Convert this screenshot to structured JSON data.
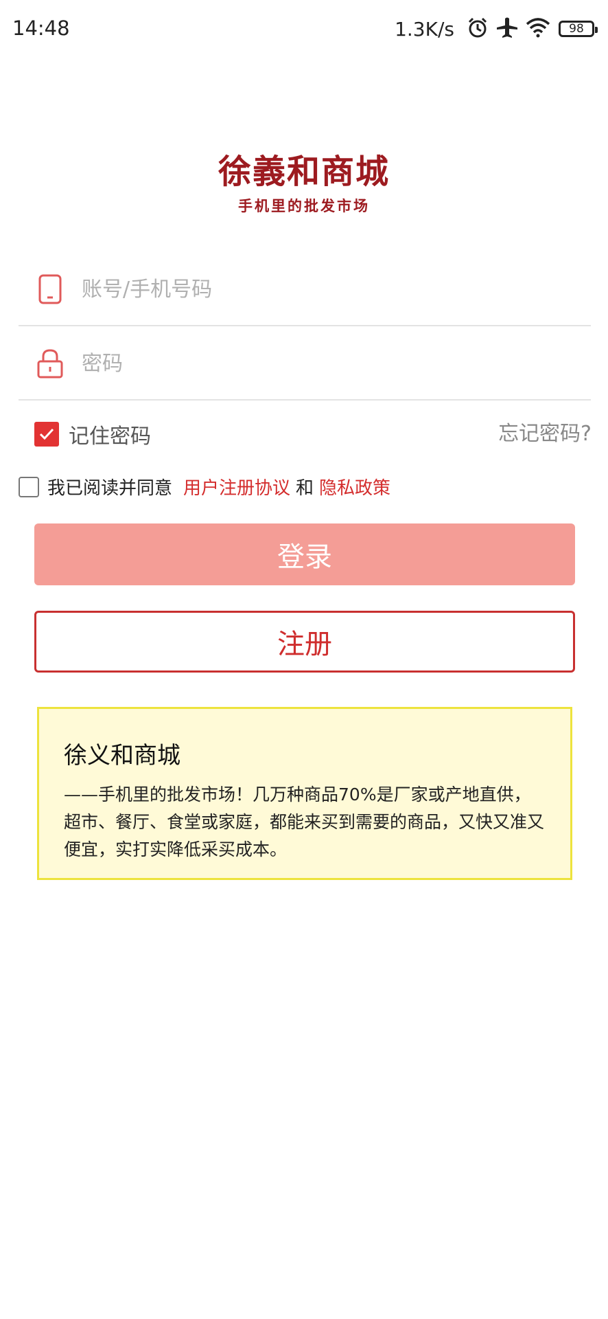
{
  "status_bar": {
    "time": "14:48",
    "net_speed": "1.3K/s",
    "battery": "98",
    "icons": [
      "alarm-icon",
      "airplane-icon",
      "wifi-icon",
      "battery-icon"
    ]
  },
  "logo": {
    "title": "徐義和商城",
    "slogan": "手机里的批发市场"
  },
  "form": {
    "account_placeholder": "账号/手机号码",
    "password_placeholder": "密码",
    "remember_label": "记住密码",
    "remember_checked": true,
    "forgot_label": "忘记密码?"
  },
  "agreement": {
    "prefix": "我已阅读并同意",
    "user_agreement": "用户注册协议",
    "and": "和",
    "privacy_policy": "隐私政策",
    "checked": false
  },
  "buttons": {
    "login": "登录",
    "register": "注册"
  },
  "info": {
    "title": "徐义和商城",
    "body": "——手机里的批发市场！几万种商品70%是厂家或产地直供，超市、餐厅、食堂或家庭，都能来买到需要的商品，又快又准又便宜，实打实降低采买成本。"
  },
  "colors": {
    "brand_dark_red": "#9d1b20",
    "accent_red": "#e23333",
    "login_button": "#f49d96",
    "link_red": "#d42d2d",
    "info_bg": "#fffad7",
    "info_border": "#ede33d"
  }
}
